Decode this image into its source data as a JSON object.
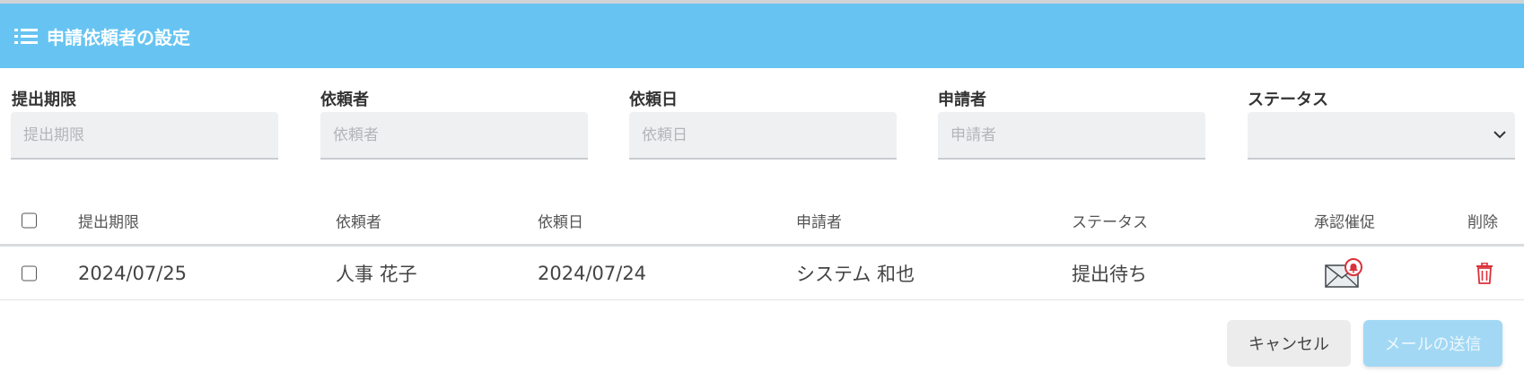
{
  "header": {
    "title": "申請依頼者の設定",
    "icon": "list-icon"
  },
  "filters": [
    {
      "label": "提出期限",
      "placeholder": "提出期限"
    },
    {
      "label": "依頼者",
      "placeholder": "依頼者"
    },
    {
      "label": "依頼日",
      "placeholder": "依頼日"
    },
    {
      "label": "申請者",
      "placeholder": "申請者"
    },
    {
      "label": "ステータス",
      "selected": ""
    }
  ],
  "table": {
    "columns": [
      "提出期限",
      "依頼者",
      "依頼日",
      "申請者",
      "ステータス",
      "承認催促",
      "削除"
    ],
    "rows": [
      {
        "deadline": "2024/07/25",
        "requester": "人事 花子",
        "request_date": "2024/07/24",
        "applicant": "システム 和也",
        "status": "提出待ち",
        "reminder_icon": "mail-bell-icon",
        "delete_icon": "trash-icon"
      }
    ]
  },
  "buttons": {
    "cancel": "キャンセル",
    "send": "メールの送信"
  },
  "colors": {
    "header": "#67c4f2",
    "delete": "#d9313a",
    "send_disabled": "#a2d8f4"
  }
}
